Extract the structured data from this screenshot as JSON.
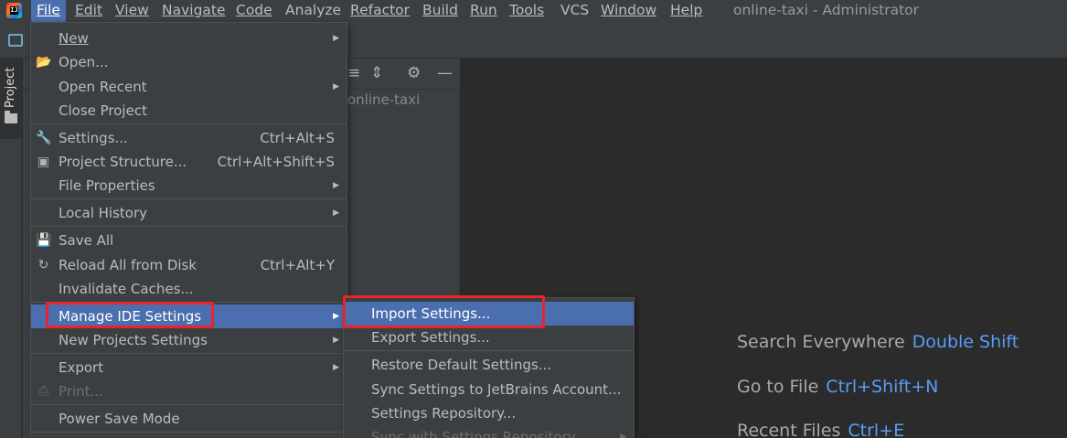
{
  "menubar": {
    "items": [
      {
        "label": "File",
        "mnemonic_index": 0
      },
      {
        "label": "Edit",
        "mnemonic_index": 0
      },
      {
        "label": "View",
        "mnemonic_index": 0
      },
      {
        "label": "Navigate",
        "mnemonic_index": 0
      },
      {
        "label": "Code",
        "mnemonic_index": 0
      },
      {
        "label": "Analyze",
        "mnemonic_index": 4
      },
      {
        "label": "Refactor",
        "mnemonic_index": 0
      },
      {
        "label": "Build",
        "mnemonic_index": 0
      },
      {
        "label": "Run",
        "mnemonic_index": 0
      },
      {
        "label": "Tools",
        "mnemonic_index": 0
      },
      {
        "label": "VCS",
        "mnemonic_index": 1
      },
      {
        "label": "Window",
        "mnemonic_index": 0
      },
      {
        "label": "Help",
        "mnemonic_index": 0
      }
    ],
    "window_title": "online-taxi - Administrator"
  },
  "tool_strip": {
    "project_label": "Project"
  },
  "project_panel": {
    "root_label": "online-taxi"
  },
  "file_menu": {
    "items": [
      {
        "label": "New",
        "underline": "N",
        "shortcut": "",
        "submenu": true,
        "icon": ""
      },
      {
        "label": "Open...",
        "underline": "O",
        "shortcut": "",
        "submenu": false,
        "icon": "folder-open-icon"
      },
      {
        "label": "Open Recent",
        "underline": "R",
        "shortcut": "",
        "submenu": true,
        "icon": ""
      },
      {
        "label": "Close Project",
        "underline": "",
        "shortcut": "",
        "submenu": false,
        "icon": ""
      },
      {
        "label": "Settings...",
        "underline": "t",
        "shortcut": "Ctrl+Alt+S",
        "submenu": false,
        "icon": "wrench-icon"
      },
      {
        "label": "Project Structure...",
        "underline": "",
        "shortcut": "Ctrl+Alt+Shift+S",
        "submenu": false,
        "icon": "project-structure-icon"
      },
      {
        "label": "File Properties",
        "underline": "",
        "shortcut": "",
        "submenu": true,
        "icon": ""
      },
      {
        "label": "Local History",
        "underline": "H",
        "shortcut": "",
        "submenu": true,
        "icon": ""
      },
      {
        "label": "Save All",
        "underline": "S",
        "shortcut": "",
        "submenu": false,
        "icon": "save-icon"
      },
      {
        "label": "Reload All from Disk",
        "underline": "",
        "shortcut": "Ctrl+Alt+Y",
        "submenu": false,
        "icon": "reload-icon"
      },
      {
        "label": "Invalidate Caches...",
        "underline": "",
        "shortcut": "",
        "submenu": false,
        "icon": ""
      },
      {
        "label": "Manage IDE Settings",
        "underline": "",
        "shortcut": "",
        "submenu": true,
        "icon": ""
      },
      {
        "label": "New Projects Settings",
        "underline": "",
        "shortcut": "",
        "submenu": true,
        "icon": ""
      },
      {
        "label": "Export",
        "underline": "",
        "shortcut": "",
        "submenu": true,
        "icon": ""
      },
      {
        "label": "Print...",
        "underline": "P",
        "shortcut": "",
        "submenu": false,
        "icon": "print-icon",
        "disabled": true
      },
      {
        "label": "Power Save Mode",
        "underline": "",
        "shortcut": "",
        "submenu": false,
        "icon": ""
      }
    ],
    "selected": "Manage IDE Settings"
  },
  "manage_settings_submenu": {
    "items": [
      {
        "label": "Import Settings...",
        "underline": ""
      },
      {
        "label": "Export Settings...",
        "underline": "E"
      },
      {
        "label": "Restore Default Settings...",
        "underline": ""
      },
      {
        "label": "Sync Settings to JetBrains Account...",
        "underline": ""
      },
      {
        "label": "Settings Repository...",
        "underline": ""
      },
      {
        "label": "Sync with Settings Repository",
        "underline": "",
        "disabled": true
      }
    ],
    "selected": "Import Settings..."
  },
  "editor_hints": [
    {
      "label": "Search Everywhere",
      "key": "Double Shift"
    },
    {
      "label": "Go to File",
      "key": "Ctrl+Shift+N"
    },
    {
      "label": "Recent Files",
      "key": "Ctrl+E"
    }
  ],
  "colors": {
    "menu_bg": "#3c3f41",
    "editor_bg": "#2b2b2b",
    "selection": "#4b6eaf",
    "hint_key": "#589df6",
    "highlight_box": "#e8252b"
  }
}
